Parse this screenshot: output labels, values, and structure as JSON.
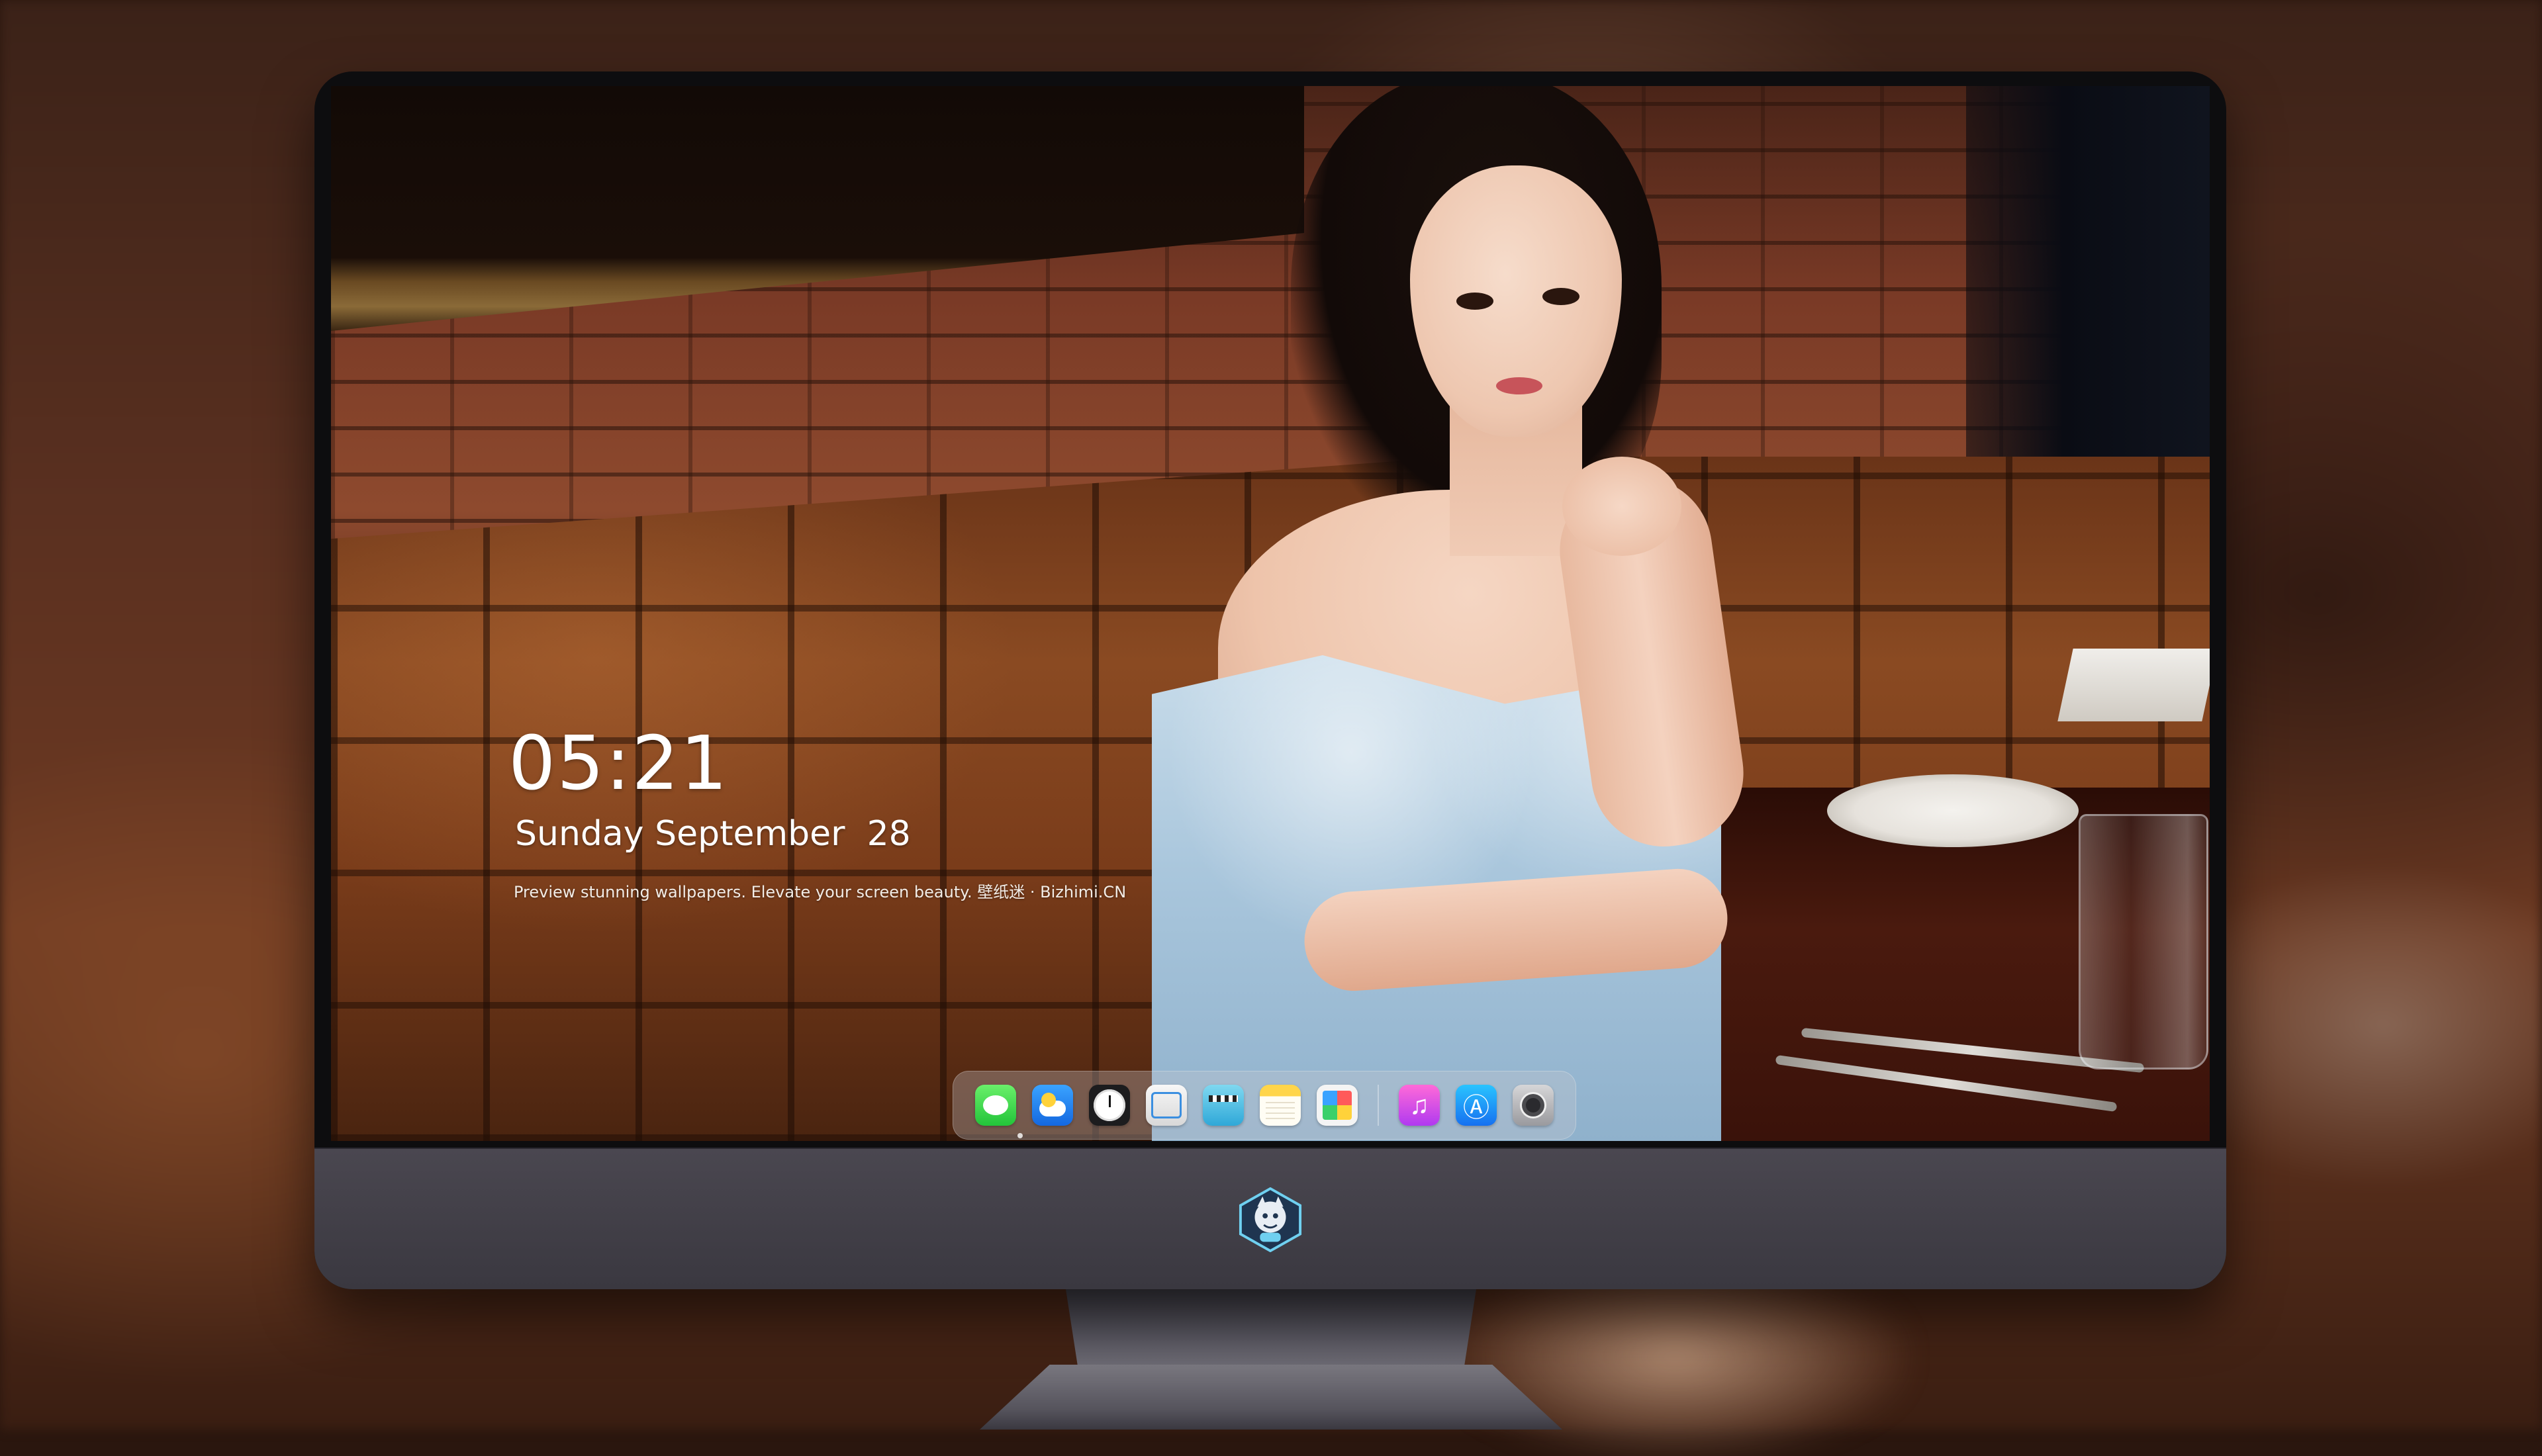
{
  "lock_screen": {
    "time": "05:21",
    "date": "Sunday September  28",
    "tagline": "Preview stunning wallpapers. Elevate your screen beauty. 壁纸迷 · Bizhimi.CN"
  },
  "dock": {
    "apps": [
      {
        "icon": "messages-icon"
      },
      {
        "icon": "weather-icon"
      },
      {
        "icon": "clock-icon"
      },
      {
        "icon": "preview-icon"
      },
      {
        "icon": "clips-icon"
      },
      {
        "icon": "notes-icon"
      },
      {
        "icon": "photos-icon"
      },
      {
        "icon": "music-icon",
        "glyph": "♫"
      },
      {
        "icon": "app-store-icon",
        "glyph": "Ⓐ"
      },
      {
        "icon": "camera-icon"
      }
    ]
  },
  "monitor": {
    "logo": "bizhimi-logo-icon"
  },
  "colors": {
    "chin": "#3a3840",
    "dock_bg": "#c8c8cd",
    "dress": "#a9c6dc"
  }
}
